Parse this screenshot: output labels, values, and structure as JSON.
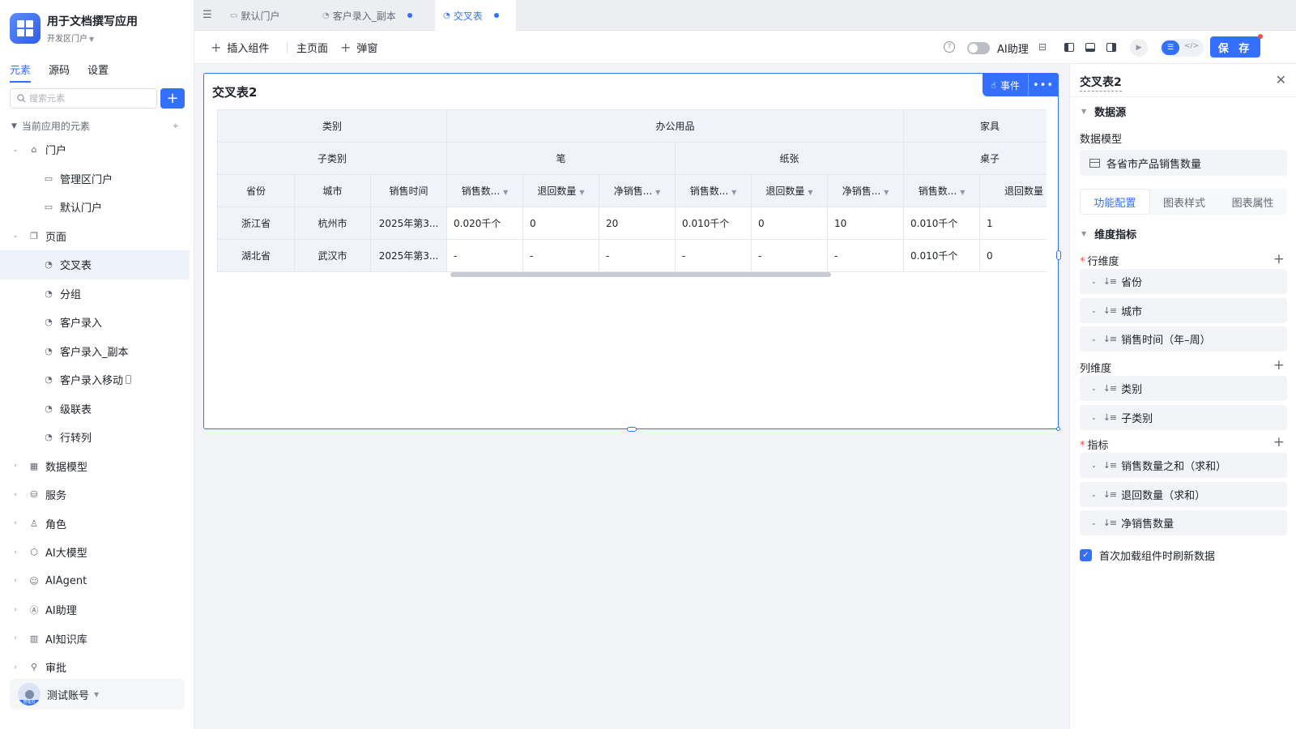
{
  "app": {
    "title": "用于文档撰写应用",
    "portal": "开发区门户"
  },
  "side_tabs": [
    "元素",
    "源码",
    "设置"
  ],
  "search": {
    "placeholder": "搜索元素"
  },
  "tree_header": "当前应用的元素",
  "tree": [
    {
      "label": "门户",
      "icon": "home-icon",
      "level": 0,
      "expanded": true
    },
    {
      "label": "管理区门户",
      "icon": "portal-icon",
      "level": 1
    },
    {
      "label": "默认门户",
      "icon": "portal-icon",
      "level": 1
    },
    {
      "label": "页面",
      "icon": "pages-icon",
      "level": 0,
      "expanded": true
    },
    {
      "label": "交叉表",
      "icon": "page-icon",
      "level": 1,
      "active": true
    },
    {
      "label": "分组",
      "icon": "page-icon",
      "level": 1
    },
    {
      "label": "客户录入",
      "icon": "page-icon",
      "level": 1
    },
    {
      "label": "客户录入_副本",
      "icon": "page-icon",
      "level": 1
    },
    {
      "label": "客户录入移动",
      "icon": "page-icon",
      "level": 1,
      "mobile": true
    },
    {
      "label": "级联表",
      "icon": "page-icon",
      "level": 1
    },
    {
      "label": "行转列",
      "icon": "page-icon",
      "level": 1
    },
    {
      "label": "数据模型",
      "icon": "table-icon",
      "level": 0
    },
    {
      "label": "服务",
      "icon": "service-icon",
      "level": 0
    },
    {
      "label": "角色",
      "icon": "role-icon",
      "level": 0
    },
    {
      "label": "AI大模型",
      "icon": "model-icon",
      "level": 0
    },
    {
      "label": "AIAgent",
      "icon": "robot-icon",
      "level": 0
    },
    {
      "label": "AI助理",
      "icon": "ai-assistant-icon",
      "level": 0
    },
    {
      "label": "AI知识库",
      "icon": "knowledge-icon",
      "level": 0
    },
    {
      "label": "审批",
      "icon": "approve-icon",
      "level": 0
    }
  ],
  "user": {
    "name": "测试账号",
    "role": "管理员"
  },
  "tabs": [
    {
      "label": "默认门户",
      "active": false,
      "dot": false
    },
    {
      "label": "客户录入_副本",
      "active": false,
      "dot": true
    },
    {
      "label": "交叉表",
      "active": true,
      "dot": true
    }
  ],
  "toolbar": {
    "insert": "插入组件",
    "home": "主页面",
    "popup": "弹窗",
    "ai_assistant": "AI助理",
    "save": "保 存"
  },
  "component": {
    "title": "交叉表2",
    "event": "事件"
  },
  "pivot": {
    "h1": [
      "类别",
      "办公用品",
      "家具"
    ],
    "h2": [
      "子类别",
      "笔",
      "纸张",
      "桌子"
    ],
    "h3": [
      "省份",
      "城市",
      "销售时间",
      "销售数...",
      "退回数量",
      "净销售...",
      "销售数...",
      "退回数量",
      "净销售...",
      "销售数...",
      "退回数量"
    ],
    "rows": [
      [
        "浙江省",
        "杭州市",
        "2025年第3...",
        "0.020千个",
        "0",
        "20",
        "0.010千个",
        "0",
        "10",
        "0.010千个",
        "1"
      ],
      [
        "湖北省",
        "武汉市",
        "2025年第3...",
        "-",
        "-",
        "-",
        "-",
        "-",
        "-",
        "0.010千个",
        "0"
      ]
    ]
  },
  "panel": {
    "title": "交叉表2",
    "datasource": "数据源",
    "model_label": "数据模型",
    "model_value": "各省市产品销售数量",
    "tabs": [
      "功能配置",
      "图表样式",
      "图表属性"
    ],
    "dim_section": "维度指标",
    "row_dim_label": "行维度",
    "row_dims": [
      "省份",
      "城市",
      "销售时间（年–周）"
    ],
    "col_dim_label": "列维度",
    "col_dims": [
      "类别",
      "子类别"
    ],
    "metric_label": "指标",
    "metrics": [
      "销售数量之和（求和）",
      "退回数量（求和）",
      "净销售数量"
    ],
    "refresh_label": "首次加载组件时刷新数据"
  },
  "colors": {
    "accent": "#3370ff",
    "danger": "#f54a45"
  }
}
